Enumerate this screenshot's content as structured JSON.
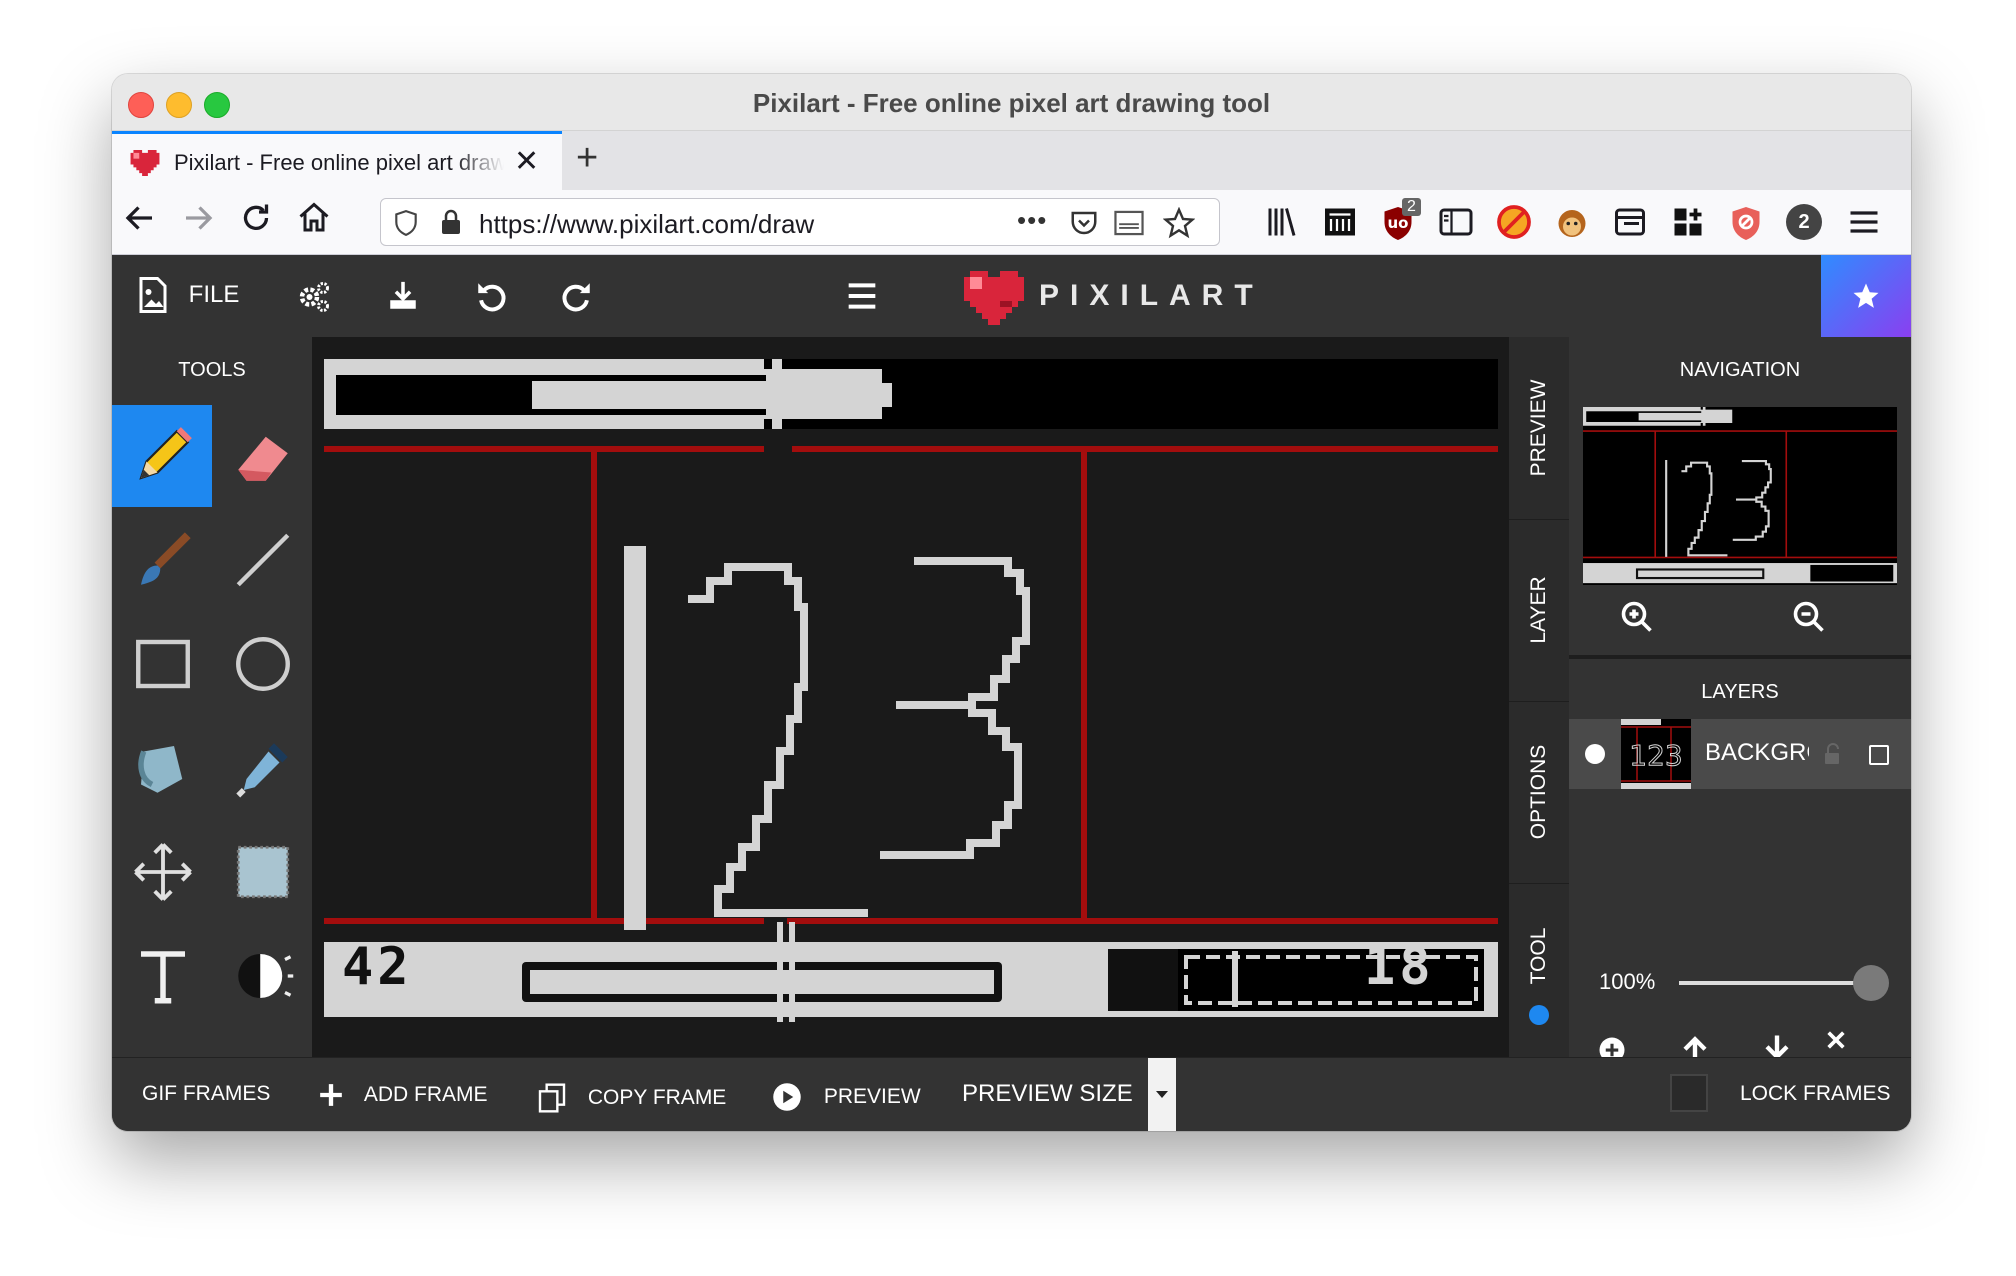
{
  "window": {
    "title": "Pixilart - Free online pixel art drawing tool"
  },
  "tab": {
    "title": "Pixilart - Free online pixel art drawing tool"
  },
  "url": "https://www.pixilart.com/draw",
  "extensions": {
    "ublock_count": "2",
    "account_badge": "2"
  },
  "app": {
    "file_label": "FILE",
    "logo": "PIXILART",
    "tools_title": "TOOLS",
    "canvas_text": "123",
    "hud_left": "42",
    "hud_right": "18",
    "side_tabs": [
      "PREVIEW",
      "LAYER",
      "OPTIONS",
      "TOOL"
    ],
    "navigation_title": "NAVIGATION",
    "layers_title": "LAYERS",
    "layer_name": "BACKGROUND",
    "zoom": "100%",
    "zoom_fraction": 1.0
  },
  "bottom": {
    "gif_frames": "GIF FRAMES",
    "add_frame": "ADD FRAME",
    "copy_frame": "COPY FRAME",
    "preview": "PREVIEW",
    "preview_size": "PREVIEW SIZE",
    "lock_frames": "LOCK FRAMES"
  },
  "colors": {
    "accent": "#1e88f0",
    "canvas_bg": "#1a1a1a",
    "red_line": "#a30d0d",
    "pixel_white": "#d4d4d4"
  }
}
